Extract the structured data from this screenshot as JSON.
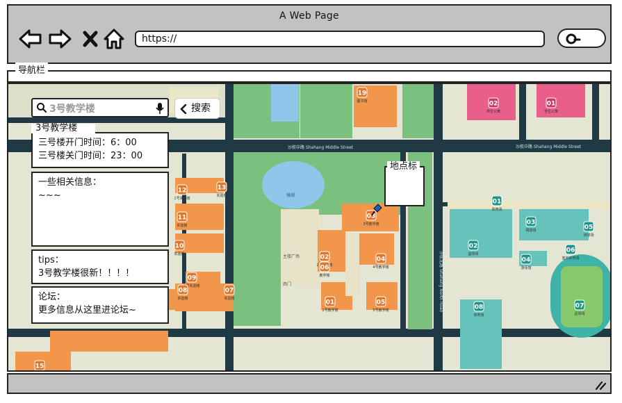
{
  "window": {
    "title": "A Web Page"
  },
  "address_bar": {
    "url": "https://"
  },
  "navbar": {
    "label": "导航栏"
  },
  "search": {
    "query": "3号教学楼",
    "button_label": "搜索"
  },
  "building": {
    "name": "3号教学楼",
    "open_time": "三号楼开门时间：6：00",
    "close_time": "三号楼关门时间：23：00"
  },
  "related": {
    "title": "一些相关信息：",
    "content": "~~~"
  },
  "tips": {
    "title": "tips：",
    "content": "3号教学楼很新！！！！"
  },
  "forum": {
    "title": "论坛：",
    "content": "更多信息从这里进论坛~"
  },
  "marker": {
    "label": "地点标"
  },
  "map": {
    "road_top": "沙航中路 Shahang Middle Street",
    "road_top_right": "沙航中路 Shahang Middle Street",
    "road_vertical": "沙航北路 Shahang North Road",
    "lake": "镜湖",
    "square": "主楼广场",
    "gate": "西门",
    "buildings": [
      {
        "num": "19",
        "name": "图书馆"
      },
      {
        "num": "12",
        "name": "1号实验楼"
      },
      {
        "num": "13",
        "name": "实验楼"
      },
      {
        "num": "11",
        "name": "实验楼"
      },
      {
        "num": "10",
        "name": "实验楼"
      },
      {
        "num": "09",
        "name": "3号实验楼"
      },
      {
        "num": "08",
        "name": "实验楼"
      },
      {
        "num": "07",
        "name": "实验楼"
      },
      {
        "num": "03",
        "name": "3号教学楼"
      },
      {
        "num": "02",
        "name": "2号教学楼"
      },
      {
        "num": "06",
        "name": "教学楼"
      },
      {
        "num": "04",
        "name": "4号教学楼"
      },
      {
        "num": "01",
        "name": "1号教学楼"
      },
      {
        "num": "05",
        "name": "5号教学楼"
      },
      {
        "num": "15",
        "name": ""
      },
      {
        "num": "02",
        "name": "学生公寓"
      },
      {
        "num": "01",
        "name": "学生公寓"
      },
      {
        "num": "01",
        "name": "体育场"
      },
      {
        "num": "03",
        "name": "网球场"
      },
      {
        "num": "02",
        "name": "篮球场"
      },
      {
        "num": "05",
        "name": "排球场"
      },
      {
        "num": "06",
        "name": "室内体育场"
      },
      {
        "num": "04",
        "name": "游泳馆"
      },
      {
        "num": "07",
        "name": "足球场"
      },
      {
        "num": "08",
        "name": "体育馆"
      }
    ]
  },
  "colors": {
    "chrome_gray": "#c2c2c2",
    "map_base": "#e4e6d3",
    "road": "#1f3a45",
    "green": "#7cc07f",
    "orange": "#f1964a",
    "pink": "#e85f8a",
    "teal": "#3fb3a7",
    "water": "#8fc7ea"
  },
  "icons": [
    "back-arrow-icon",
    "forward-arrow-icon",
    "close-x-icon",
    "home-icon",
    "search-icon",
    "microphone-icon",
    "chevron-left-icon",
    "map-pin-icon",
    "resize-grip-icon"
  ]
}
